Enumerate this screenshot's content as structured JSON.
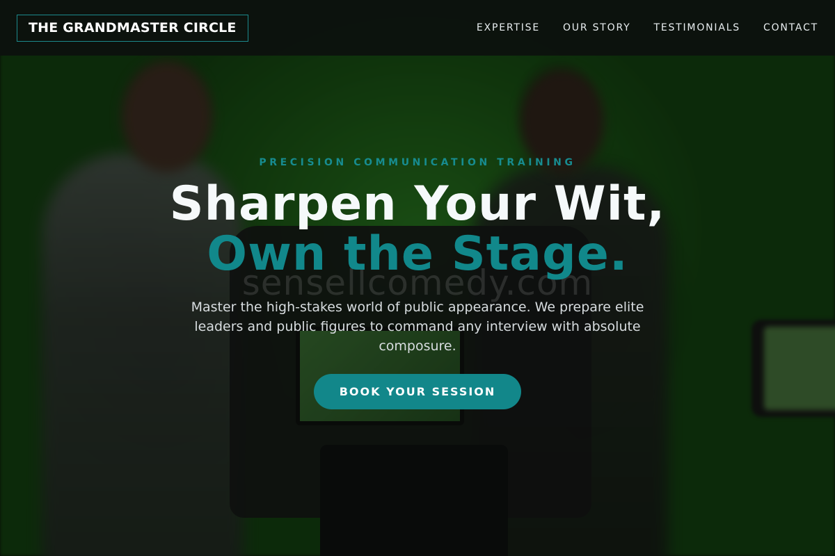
{
  "header": {
    "brand": "THE GRANDMASTER CIRCLE",
    "nav": [
      {
        "label": "EXPERTISE"
      },
      {
        "label": "OUR STORY"
      },
      {
        "label": "TESTIMONIALS"
      },
      {
        "label": "CONTACT"
      }
    ]
  },
  "hero": {
    "eyebrow": "PRECISION COMMUNICATION TRAINING",
    "headline_line1": "Sharpen Your Wit,",
    "headline_line2": "Own the Stage.",
    "watermark": "sensellcomedy.com",
    "subtitle": "Master the high-stakes world of public appearance. We prepare elite leaders and public figures to command any interview with absolute composure.",
    "cta_label": "BOOK YOUR SESSION"
  },
  "colors": {
    "accent": "#12878a",
    "header_bg": "#0c120e",
    "hero_green": "#2e8a24"
  }
}
